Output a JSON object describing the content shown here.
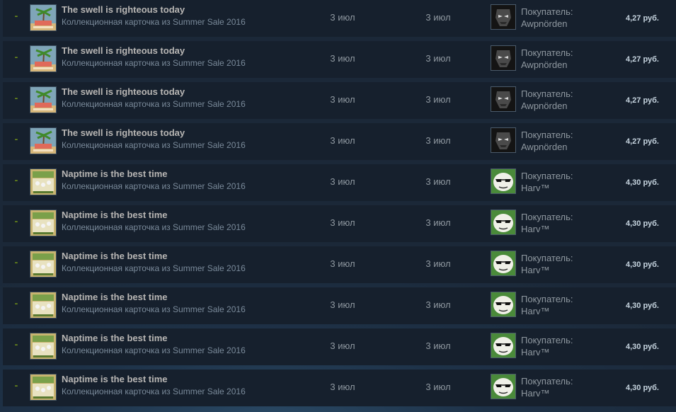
{
  "market_history": {
    "rows": [
      {
        "gain": "-",
        "item_name": "The swell is righteous today",
        "item_game": "Коллекционная карточка из Summer Sale 2016",
        "item_icon": "swell-card-icon",
        "listed": "3 июл",
        "acted": "3 июл",
        "buyer_label": "Покупатель:",
        "buyer_name": "Awpnörden",
        "buyer_avatar": "dark-masked-avatar",
        "price": "4,27 руб."
      },
      {
        "gain": "-",
        "item_name": "The swell is righteous today",
        "item_game": "Коллекционная карточка из Summer Sale 2016",
        "item_icon": "swell-card-icon",
        "listed": "3 июл",
        "acted": "3 июл",
        "buyer_label": "Покупатель:",
        "buyer_name": "Awpnörden",
        "buyer_avatar": "dark-masked-avatar",
        "price": "4,27 руб."
      },
      {
        "gain": "-",
        "item_name": "The swell is righteous today",
        "item_game": "Коллекционная карточка из Summer Sale 2016",
        "item_icon": "swell-card-icon",
        "listed": "3 июл",
        "acted": "3 июл",
        "buyer_label": "Покупатель:",
        "buyer_name": "Awpnörden",
        "buyer_avatar": "dark-masked-avatar",
        "price": "4,27 руб."
      },
      {
        "gain": "-",
        "item_name": "The swell is righteous today",
        "item_game": "Коллекционная карточка из Summer Sale 2016",
        "item_icon": "swell-card-icon",
        "listed": "3 июл",
        "acted": "3 июл",
        "buyer_label": "Покупатель:",
        "buyer_name": "Awpnörden",
        "buyer_avatar": "dark-masked-avatar",
        "price": "4,27 руб."
      },
      {
        "gain": "-",
        "item_name": "Naptime is the best time",
        "item_game": "Коллекционная карточка из Summer Sale 2016",
        "item_icon": "naptime-card-icon",
        "listed": "3 июл",
        "acted": "3 июл",
        "buyer_label": "Покупатель:",
        "buyer_name": "Harv™",
        "buyer_avatar": "sunglasses-face-avatar",
        "price": "4,30 руб."
      },
      {
        "gain": "-",
        "item_name": "Naptime is the best time",
        "item_game": "Коллекционная карточка из Summer Sale 2016",
        "item_icon": "naptime-card-icon",
        "listed": "3 июл",
        "acted": "3 июл",
        "buyer_label": "Покупатель:",
        "buyer_name": "Harv™",
        "buyer_avatar": "sunglasses-face-avatar",
        "price": "4,30 руб."
      },
      {
        "gain": "-",
        "item_name": "Naptime is the best time",
        "item_game": "Коллекционная карточка из Summer Sale 2016",
        "item_icon": "naptime-card-icon",
        "listed": "3 июл",
        "acted": "3 июл",
        "buyer_label": "Покупатель:",
        "buyer_name": "Harv™",
        "buyer_avatar": "sunglasses-face-avatar",
        "price": "4,30 руб."
      },
      {
        "gain": "-",
        "item_name": "Naptime is the best time",
        "item_game": "Коллекционная карточка из Summer Sale 2016",
        "item_icon": "naptime-card-icon",
        "listed": "3 июл",
        "acted": "3 июл",
        "buyer_label": "Покупатель:",
        "buyer_name": "Harv™",
        "buyer_avatar": "sunglasses-face-avatar",
        "price": "4,30 руб."
      },
      {
        "gain": "-",
        "item_name": "Naptime is the best time",
        "item_game": "Коллекционная карточка из Summer Sale 2016",
        "item_icon": "naptime-card-icon",
        "listed": "3 июл",
        "acted": "3 июл",
        "buyer_label": "Покупатель:",
        "buyer_name": "Harv™",
        "buyer_avatar": "sunglasses-face-avatar",
        "price": "4,30 руб."
      },
      {
        "gain": "-",
        "item_name": "Naptime is the best time",
        "item_game": "Коллекционная карточка из Summer Sale 2016",
        "item_icon": "naptime-card-icon",
        "listed": "3 июл",
        "acted": "3 июл",
        "buyer_label": "Покупатель:",
        "buyer_name": "Harv™",
        "buyer_avatar": "sunglasses-face-avatar",
        "price": "4,30 руб."
      }
    ]
  },
  "colors": {
    "background": "#1b2838",
    "row_background": "#16202d",
    "gain_green": "#6b8a1a",
    "text_muted": "#8f98a0",
    "item_name": "#b8b6b4",
    "price_text": "#c6d4df"
  }
}
